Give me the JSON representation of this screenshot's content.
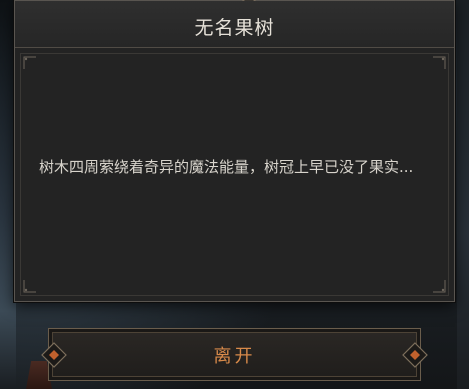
{
  "dialog": {
    "title": "无名果树",
    "body": "树木四周萦绕着奇异的魔法能量，树冠上早已没了果实..."
  },
  "actions": {
    "leave_label": "离开"
  },
  "colors": {
    "panel": "#232323",
    "title_text": "#e6e1d8",
    "body_text": "#d8d4cc",
    "accent": "#d88a4a",
    "border": "#595550"
  }
}
